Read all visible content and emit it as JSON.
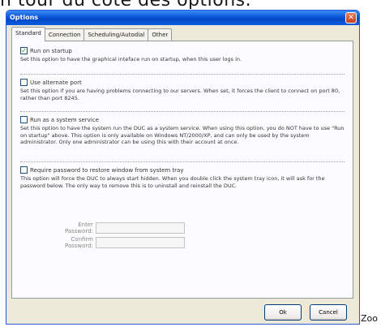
{
  "caption": "n tour du côté des options.",
  "window": {
    "title": "Options"
  },
  "tabs": [
    {
      "label": "Standard",
      "active": true
    },
    {
      "label": "Connection",
      "active": false
    },
    {
      "label": "Scheduling/Autodial",
      "active": false
    },
    {
      "label": "Other",
      "active": false
    }
  ],
  "options": [
    {
      "label": "Run on startup",
      "checked": true,
      "description": "Set this option to have the graphical inteface run on startup, when this user logs in."
    },
    {
      "label": "Use alternate port",
      "checked": false,
      "description": "Set this option if you are having problems connecting to our servers. When set, it forces the client to connect on port 80, rather than port 8245."
    },
    {
      "label": "Run as a system service",
      "checked": false,
      "description": "Set this option to have the system run the DUC as a system service. When using this option, you do NOT have to use \"Run on startup\" above. This option is only available on Windows NT/2000/XP, and can only be used by the system administrator. Only one administrator can be using this with their account at once."
    },
    {
      "label": "Require password to restore window from system tray",
      "checked": false,
      "description": "This option will force the DUC to always start hidden. When you double click the system tray icon, it will ask for the password below. The only way to remove this is to uninstall and reinstall the DUC."
    }
  ],
  "password": {
    "enter_label": "Enter Password:",
    "confirm_label": "Confirm Password:"
  },
  "buttons": {
    "ok": "Ok",
    "cancel": "Cancel"
  },
  "zoom_text": "Zoo"
}
